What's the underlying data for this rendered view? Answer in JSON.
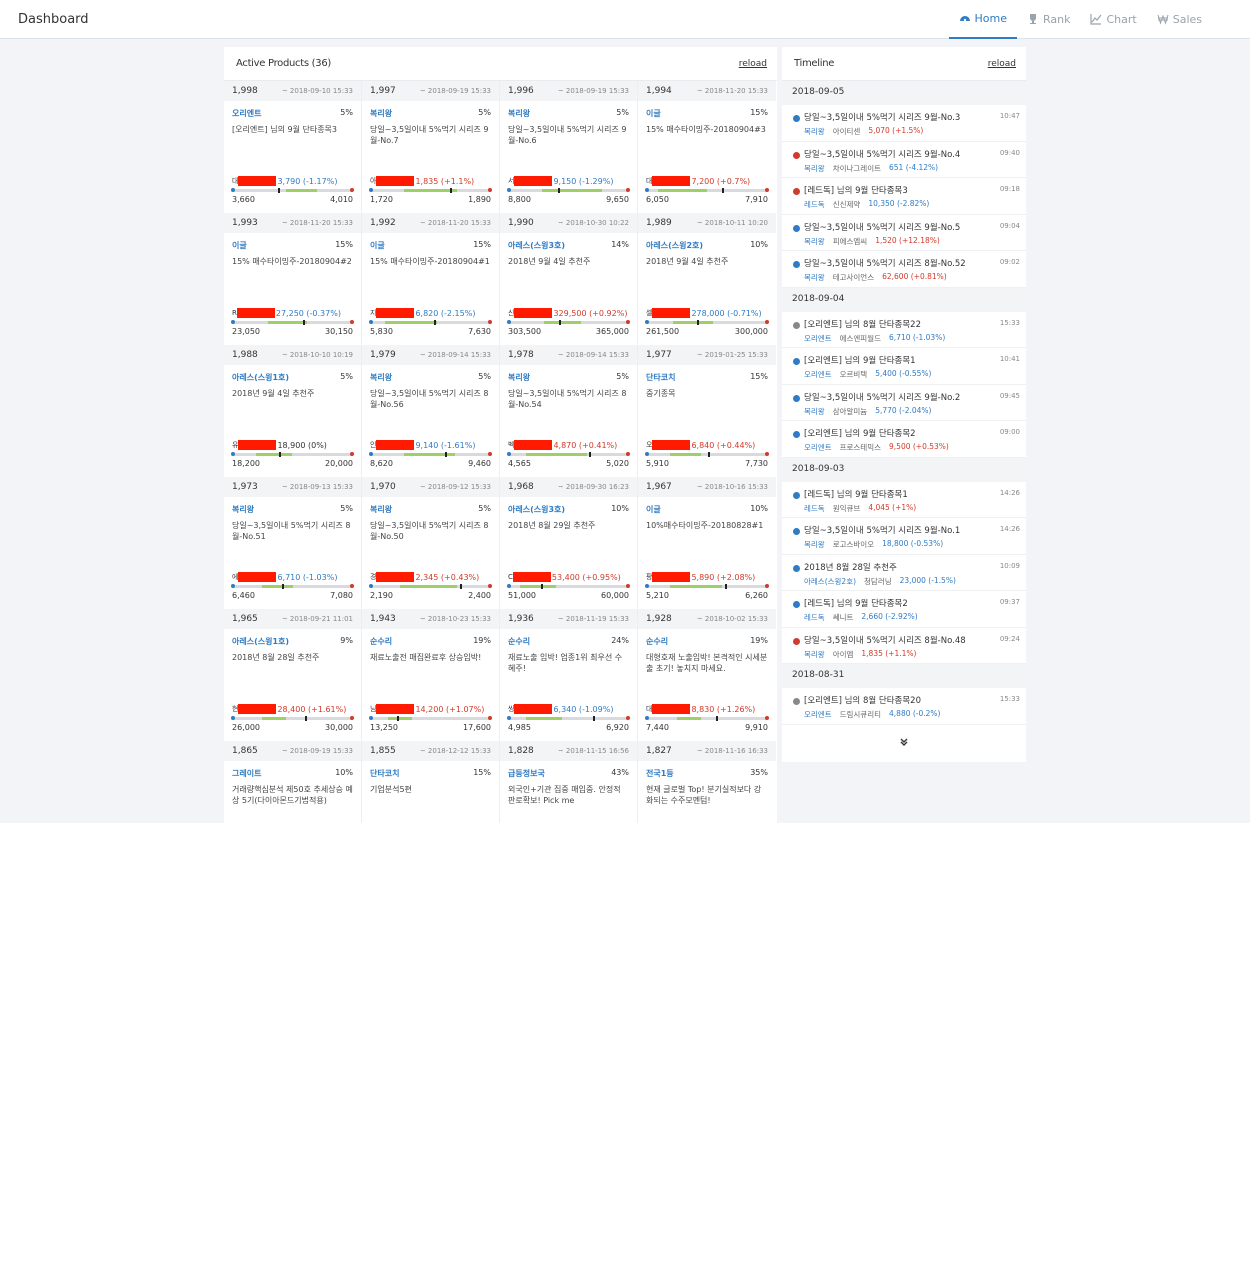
{
  "header": {
    "brand": "Dashboard",
    "nav": [
      {
        "label": "Home",
        "icon": "dashboard-icon",
        "active": true
      },
      {
        "label": "Rank",
        "icon": "trophy-icon",
        "active": false
      },
      {
        "label": "Chart",
        "icon": "line-chart-icon",
        "active": false
      },
      {
        "label": "Sales",
        "icon": "won-icon",
        "active": false
      }
    ]
  },
  "products": {
    "title": "Active Products (36)",
    "reload": "reload",
    "cards": [
      {
        "count": "1,998",
        "date": "~ 2018-09-10 15:33",
        "author": "오리엔트",
        "pct": "5%",
        "title": "[오리엔트] 님의 9월 단타종목3",
        "abbr": "대",
        "change": "3,790 (-1.17%)",
        "dir": "down",
        "low": "3,660",
        "high": "4,010",
        "fill": [
          0.45,
          0.7
        ],
        "mark": 0.38
      },
      {
        "count": "1,997",
        "date": "~ 2018-09-19 15:33",
        "author": "복리왕",
        "pct": "5%",
        "title": "당일~3,5일이내 5%먹기 시리즈 9월-No.7",
        "abbr": "아",
        "change": "1,835 (+1.1%)",
        "dir": "up",
        "low": "1,720",
        "high": "1,890",
        "fill": [
          0.28,
          0.72
        ],
        "mark": 0.66
      },
      {
        "count": "1,996",
        "date": "~ 2018-09-19 15:33",
        "author": "복리왕",
        "pct": "5%",
        "title": "당일~3,5일이내 5%먹기 시리즈 9월-No.6",
        "abbr": "서",
        "change": "9,150 (-1.29%)",
        "dir": "down",
        "low": "8,800",
        "high": "9,650",
        "fill": [
          0.28,
          0.78
        ],
        "mark": 0.41
      },
      {
        "count": "1,994",
        "date": "~ 2018-11-20 15:33",
        "author": "이글",
        "pct": "15%",
        "title": "15% 매수타이밍주-20180904#3",
        "abbr": "대",
        "change": "7,200 (+0.7%)",
        "dir": "up",
        "low": "6,050",
        "high": "7,910",
        "fill": [
          0.1,
          0.5
        ],
        "mark": 0.62
      },
      {
        "count": "1,993",
        "date": "~ 2018-11-20 15:33",
        "author": "이글",
        "pct": "15%",
        "title": "15% 매수타이밍주-20180904#2",
        "abbr": "R",
        "change": "27,250 (-0.37%)",
        "dir": "down",
        "low": "23,050",
        "high": "30,150",
        "fill": [
          0.3,
          0.62
        ],
        "mark": 0.59
      },
      {
        "count": "1,992",
        "date": "~ 2018-11-20 15:33",
        "author": "이글",
        "pct": "15%",
        "title": "15% 매수타이밍주-20180904#1",
        "abbr": "지",
        "change": "6,820 (-2.15%)",
        "dir": "down",
        "low": "5,830",
        "high": "7,630",
        "fill": [
          0.12,
          0.55
        ],
        "mark": 0.53
      },
      {
        "count": "1,990",
        "date": "~ 2018-10-30 10:22",
        "author": "아레스(스윙3호)",
        "pct": "14%",
        "title": "2018년 9월 4일 추천주",
        "abbr": "신",
        "change": "329,500 (+0.92%)",
        "dir": "up",
        "low": "303,500",
        "high": "365,000",
        "fill": [
          0.3,
          0.6
        ],
        "mark": 0.42
      },
      {
        "count": "1,989",
        "date": "~ 2018-10-11 10:20",
        "author": "아레스(스윙2호)",
        "pct": "10%",
        "title": "2018년 9월 4일 추천주",
        "abbr": "셀",
        "change": "278,000 (-0.71%)",
        "dir": "down",
        "low": "261,500",
        "high": "300,000",
        "fill": [
          0.22,
          0.55
        ],
        "mark": 0.42
      },
      {
        "count": "1,988",
        "date": "~ 2018-10-10 10:19",
        "author": "아레스(스윙1호)",
        "pct": "5%",
        "title": "2018년 9월 4일 추천주",
        "abbr": "유",
        "change": "18,900 (0%)",
        "dir": "flat",
        "low": "18,200",
        "high": "20,000",
        "fill": [
          0.2,
          0.5
        ],
        "mark": 0.39
      },
      {
        "count": "1,979",
        "date": "~ 2018-09-14 15:33",
        "author": "복리왕",
        "pct": "5%",
        "title": "당일~3,5일이내 5%먹기 시리즈 8월-No.56",
        "abbr": "인",
        "change": "9,140 (-1.61%)",
        "dir": "down",
        "low": "8,620",
        "high": "9,460",
        "fill": [
          0.28,
          0.7
        ],
        "mark": 0.62
      },
      {
        "count": "1,978",
        "date": "~ 2018-09-14 15:33",
        "author": "복리왕",
        "pct": "5%",
        "title": "당일~3,5일이내 5%먹기 시리즈 8월-No.54",
        "abbr": "벡",
        "change": "4,870 (+0.41%)",
        "dir": "up",
        "low": "4,565",
        "high": "5,020",
        "fill": [
          0.15,
          0.65
        ],
        "mark": 0.67
      },
      {
        "count": "1,977",
        "date": "~ 2019-01-25 15:33",
        "author": "단타코치",
        "pct": "15%",
        "title": "중기종목",
        "abbr": "오",
        "change": "6,840 (+0.44%)",
        "dir": "up",
        "low": "5,910",
        "high": "7,730",
        "fill": [
          0.2,
          0.45
        ],
        "mark": 0.51
      },
      {
        "count": "1,973",
        "date": "~ 2018-09-13 15:33",
        "author": "복리왕",
        "pct": "5%",
        "title": "당일~3,5일이내 5%먹기 시리즈 8월-No.51",
        "abbr": "에",
        "change": "6,710 (-1.03%)",
        "dir": "down",
        "low": "6,460",
        "high": "7,080",
        "fill": [
          0.25,
          0.5
        ],
        "mark": 0.41
      },
      {
        "count": "1,970",
        "date": "~ 2018-09-12 15:33",
        "author": "복리왕",
        "pct": "5%",
        "title": "당일~3,5일이내 5%먹기 시리즈 8월-No.50",
        "abbr": "경",
        "change": "2,345 (+0.43%)",
        "dir": "up",
        "low": "2,190",
        "high": "2,400",
        "fill": [
          0.25,
          0.72
        ],
        "mark": 0.74
      },
      {
        "count": "1,968",
        "date": "~ 2018-09-30 16:23",
        "author": "아레스(스윙3호)",
        "pct": "10%",
        "title": "2018년 8월 29일 추천주",
        "abbr": "C",
        "change": "53,400 (+0.95%)",
        "dir": "up",
        "low": "51,000",
        "high": "60,000",
        "fill": [
          0.1,
          0.4
        ],
        "mark": 0.27
      },
      {
        "count": "1,967",
        "date": "~ 2018-10-16 15:33",
        "author": "이글",
        "pct": "10%",
        "title": "10%매수타이밍주-20180828#1",
        "abbr": "팡",
        "change": "5,890 (+2.08%)",
        "dir": "up",
        "low": "5,210",
        "high": "6,260",
        "fill": [
          0.2,
          0.62
        ],
        "mark": 0.65
      },
      {
        "count": "1,965",
        "date": "~ 2018-09-21 11:01",
        "author": "아레스(스윙1호)",
        "pct": "9%",
        "title": "2018년 8월 28일 추천주",
        "abbr": "현",
        "change": "28,400 (+1.61%)",
        "dir": "up",
        "low": "26,000",
        "high": "30,000",
        "fill": [
          0.25,
          0.45
        ],
        "mark": 0.6
      },
      {
        "count": "1,943",
        "date": "~ 2018-10-23 15:33",
        "author": "순수리",
        "pct": "19%",
        "title": "재료노출전 매집완료후 상승임박!",
        "abbr": "님",
        "change": "14,200 (+1.07%)",
        "dir": "up",
        "low": "13,250",
        "high": "17,600",
        "fill": [
          0.15,
          0.35
        ],
        "mark": 0.22
      },
      {
        "count": "1,936",
        "date": "~ 2018-11-19 15:33",
        "author": "순수리",
        "pct": "24%",
        "title": "재료노출 임박! 업종1위 최우선 수혜주!",
        "abbr": "씽",
        "change": "6,340 (-1.09%)",
        "dir": "down",
        "low": "4,985",
        "high": "6,920",
        "fill": [
          0.15,
          0.45
        ],
        "mark": 0.7
      },
      {
        "count": "1,928",
        "date": "~ 2018-10-02 15:33",
        "author": "순수리",
        "pct": "19%",
        "title": "대형호재 노출임박! 본격적인 시세분출 초기! 놓치지 마세요.",
        "abbr": "대",
        "change": "8,830 (+1.26%)",
        "dir": "up",
        "low": "7,440",
        "high": "9,910",
        "fill": [
          0.25,
          0.45
        ],
        "mark": 0.57
      },
      {
        "count": "1,865",
        "date": "~ 2018-09-19 15:33",
        "author": "그레이트",
        "pct": "10%",
        "title": "거래량핵심분석 제50호 추세상승 예상 5기(다이아몬드기법적용)"
      },
      {
        "count": "1,855",
        "date": "~ 2018-12-12 15:33",
        "author": "단타코치",
        "pct": "15%",
        "title": "기업분석5편"
      },
      {
        "count": "1,828",
        "date": "~ 2018-11-15 16:56",
        "author": "급등정보국",
        "pct": "43%",
        "title": "외국인+기관 집중 매입중. 안정적 판로확보! Pick me"
      },
      {
        "count": "1,827",
        "date": "~ 2018-11-16 16:33",
        "author": "전국1등",
        "pct": "35%",
        "title": "현재 글로벌 Top! 분기실적보다 강화되는 수주모멘텀!"
      }
    ]
  },
  "timeline": {
    "title": "Timeline",
    "reload": "reload",
    "groups": [
      {
        "date": "2018-09-05",
        "items": [
          {
            "title": "당일~3,5일이내 5%먹기 시리즈 9월-No.3",
            "time": "10:47",
            "author": "복리왕",
            "stock": "아이티센",
            "change": "5,070 (+1.5%)",
            "dir": "up",
            "dot": "#2f7bc4"
          },
          {
            "title": "당일~3,5일이내 5%먹기 시리즈 9월-No.4",
            "time": "09:40",
            "author": "복리왕",
            "stock": "차이나그레이트",
            "change": "651 (-4.12%)",
            "dir": "down",
            "dot": "#d23a2a"
          },
          {
            "title": "[레드독] 님의 9월 단타종목3",
            "time": "09:18",
            "author": "레드독",
            "stock": "신신제약",
            "change": "10,350 (-2.82%)",
            "dir": "down",
            "dot": "#d23a2a"
          },
          {
            "title": "당일~3,5일이내 5%먹기 시리즈 9월-No.5",
            "time": "09:04",
            "author": "복리왕",
            "stock": "피에스엠씨",
            "change": "1,520 (+12.18%)",
            "dir": "up",
            "dot": "#2f7bc4"
          },
          {
            "title": "당일~3,5일이내 5%먹기 시리즈 8월-No.52",
            "time": "09:02",
            "author": "복리왕",
            "stock": "테고사이언스",
            "change": "62,600 (+0.81%)",
            "dir": "up",
            "dot": "#2f7bc4"
          }
        ]
      },
      {
        "date": "2018-09-04",
        "items": [
          {
            "title": "[오리엔트] 님의 8월 단타종목22",
            "time": "15:33",
            "author": "오리엔트",
            "stock": "에스엔피월드",
            "change": "6,710 (-1.03%)",
            "dir": "down",
            "dot": "#888888"
          },
          {
            "title": "[오리엔트] 님의 9월 단타종목1",
            "time": "10:41",
            "author": "오리엔트",
            "stock": "오르비텍",
            "change": "5,400 (-0.55%)",
            "dir": "down",
            "dot": "#2f7bc4"
          },
          {
            "title": "당일~3,5일이내 5%먹기 시리즈 9월-No.2",
            "time": "09:45",
            "author": "복리왕",
            "stock": "삼아알미늄",
            "change": "5,770 (-2.04%)",
            "dir": "down",
            "dot": "#2f7bc4"
          },
          {
            "title": "[오리엔트] 님의 9월 단타종목2",
            "time": "09:00",
            "author": "오리엔트",
            "stock": "프로스테믹스",
            "change": "9,500 (+0.53%)",
            "dir": "up",
            "dot": "#2f7bc4"
          }
        ]
      },
      {
        "date": "2018-09-03",
        "items": [
          {
            "title": "[레드독] 님의 9월 단타종목1",
            "time": "14:26",
            "author": "레드독",
            "stock": "원익큐브",
            "change": "4,045 (+1%)",
            "dir": "up",
            "dot": "#2f7bc4"
          },
          {
            "title": "당일~3,5일이내 5%먹기 시리즈 9월-No.1",
            "time": "14:26",
            "author": "복리왕",
            "stock": "로고스바이오",
            "change": "18,800 (-0.53%)",
            "dir": "down",
            "dot": "#2f7bc4"
          },
          {
            "title": "2018년 8월 28일 추천주",
            "time": "10:09",
            "author": "아레스(스윙2호)",
            "stock": "청담러닝",
            "change": "23,000 (-1.5%)",
            "dir": "down",
            "dot": "#2f7bc4"
          },
          {
            "title": "[레드독] 님의 9월 단타종목2",
            "time": "09:37",
            "author": "레드독",
            "stock": "쎄니트",
            "change": "2,660 (-2.92%)",
            "dir": "down",
            "dot": "#2f7bc4"
          },
          {
            "title": "당일~3,5일이내 5%먹기 시리즈 8월-No.48",
            "time": "09:24",
            "author": "복리왕",
            "stock": "아이엠",
            "change": "1,835 (+1.1%)",
            "dir": "up",
            "dot": "#d23a2a"
          }
        ]
      },
      {
        "date": "2018-08-31",
        "items": [
          {
            "title": "[오리엔트] 님의 8월 단타종목20",
            "time": "15:33",
            "author": "오리엔트",
            "stock": "드림시큐리티",
            "change": "4,880 (-0.2%)",
            "dir": "down",
            "dot": "#888888"
          }
        ]
      }
    ],
    "more": "»"
  }
}
